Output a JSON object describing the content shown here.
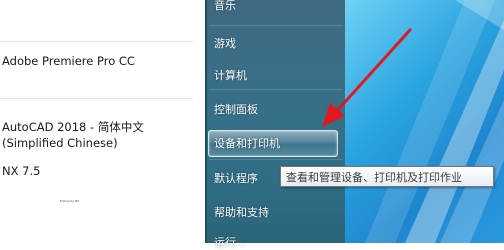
{
  "programs": [
    {
      "label": "Adobe Premiere Pro CC"
    },
    {
      "label": "AutoCAD 2018 - 简体中文"
    },
    {
      "label": "(Simplified Chinese)"
    },
    {
      "label": "NX 7.5"
    }
  ],
  "small_text": "Follow by NX",
  "menu": [
    {
      "label": "音乐"
    },
    {
      "label": "游戏"
    },
    {
      "label": "计算机"
    },
    {
      "label": "控制面板"
    },
    {
      "label": "设备和打印机"
    },
    {
      "label": "默认程序"
    },
    {
      "label": "帮助和支持"
    },
    {
      "label": "运行..."
    }
  ],
  "selected_item": "设备和打印机",
  "tooltip": "查看和管理设备、打印机及打印作业",
  "colors": {
    "arrow": "#e0191f",
    "glass_pane": "#356f88",
    "desktop": "#2aa3e0"
  }
}
